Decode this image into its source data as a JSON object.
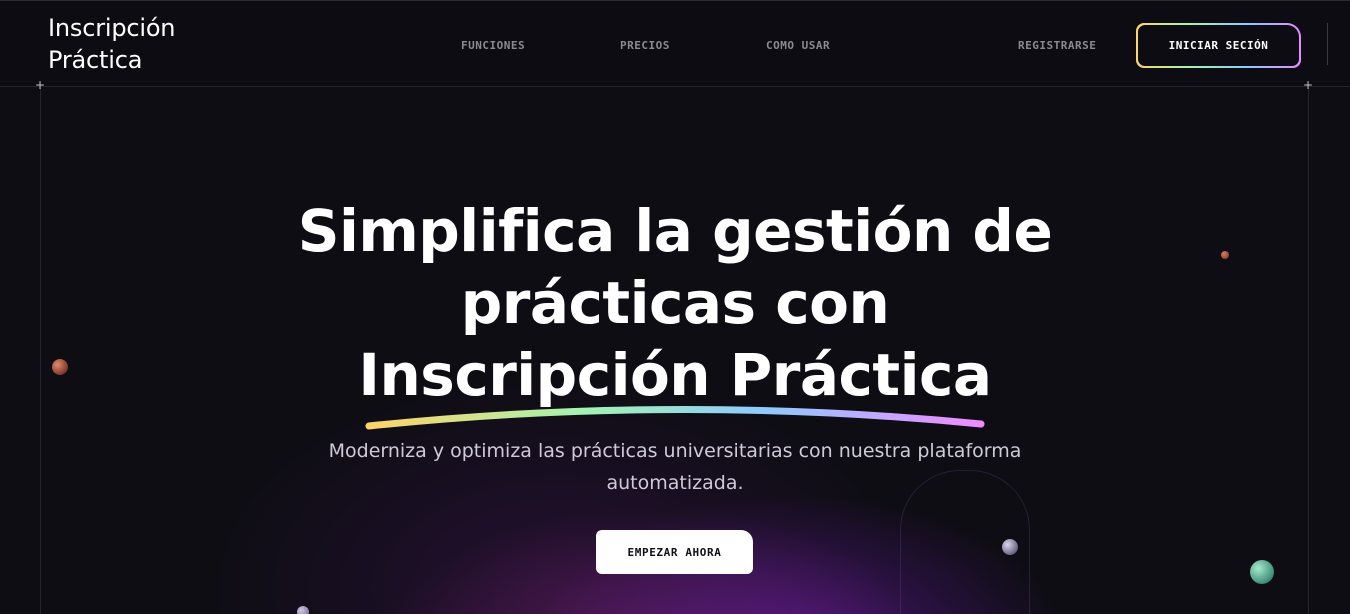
{
  "brand": {
    "line1": "Inscripción",
    "line2": "Práctica"
  },
  "nav": {
    "funciones": "FUNCIONES",
    "precios": "PRECIOS",
    "como_usar": "COMO USAR",
    "registrarse": "REGISTRARSE",
    "login": "INICIAR SECIÓN"
  },
  "hero": {
    "line1": "Simplifica la gestión de",
    "line2": "prácticas con",
    "line3": "Inscripción Práctica",
    "subtitle": "Moderniza y optimiza las prácticas universitarias con nuestra plataforma automatizada.",
    "cta": "EMPEZAR AHORA"
  },
  "colors": {
    "background": "#0e0d14",
    "accent_gradient": [
      "#ffd36a",
      "#a3f3b2",
      "#8fc9ff",
      "#e38bff"
    ],
    "glow": "#7a1ebe"
  }
}
